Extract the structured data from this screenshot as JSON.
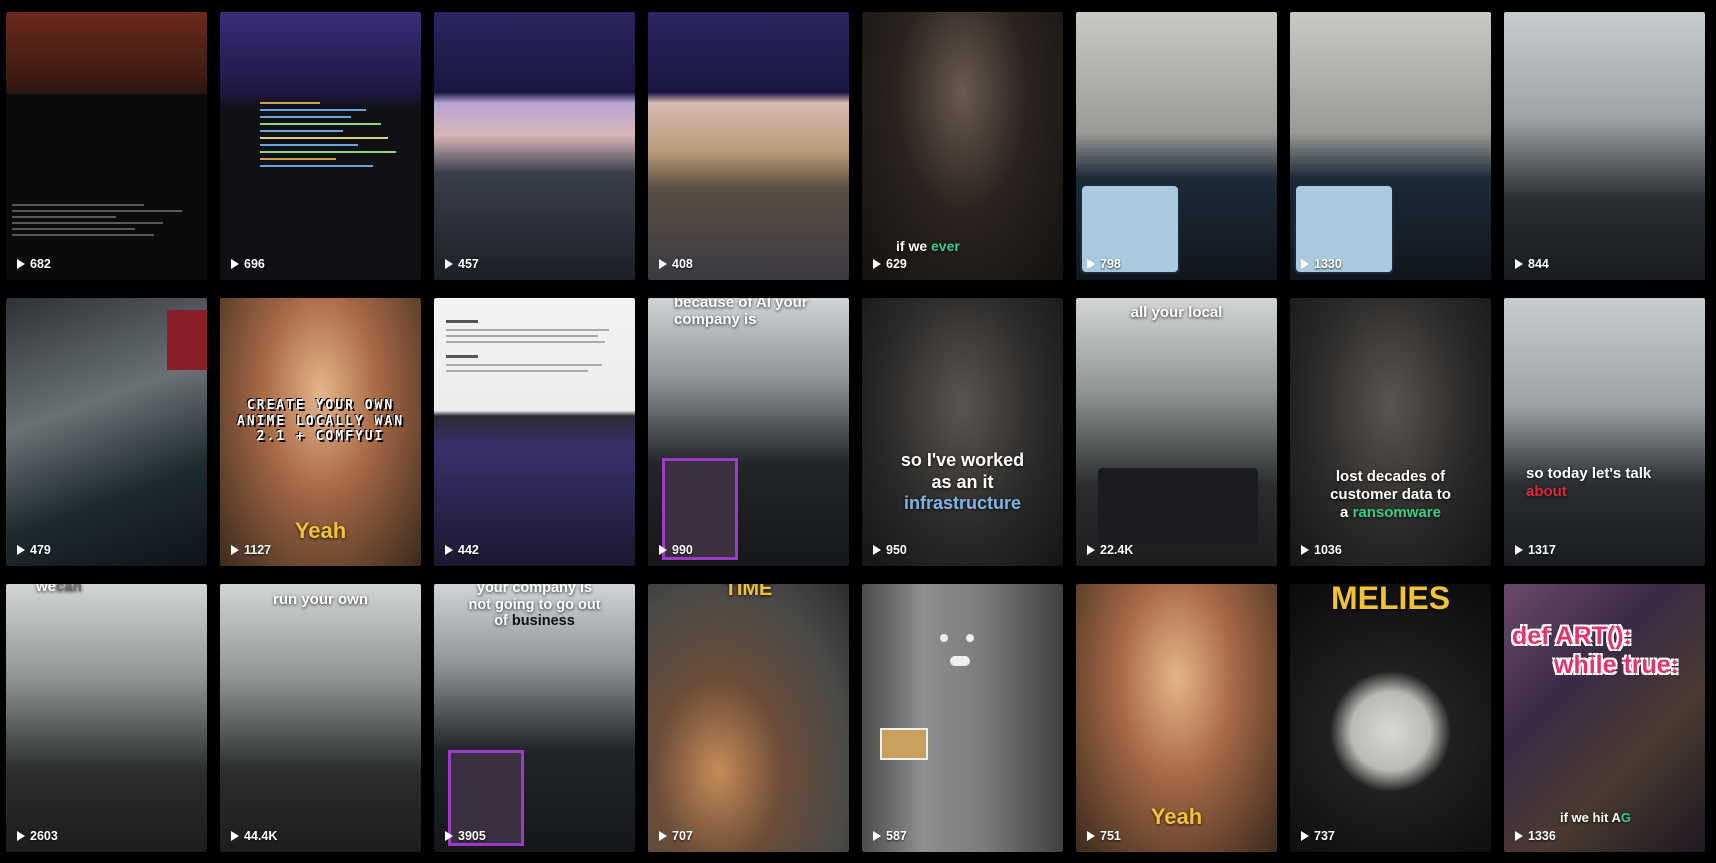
{
  "tiles": [
    {
      "views": "682",
      "theme": "studio-red"
    },
    {
      "views": "696",
      "theme": "studio-purple"
    },
    {
      "views": "457",
      "theme": "stairs"
    },
    {
      "views": "408",
      "theme": "street"
    },
    {
      "views": "629",
      "theme": "dark-person",
      "caption_parts": [
        "if we ",
        "ever"
      ]
    },
    {
      "views": "798",
      "theme": "cap-gallery"
    },
    {
      "views": "1330",
      "theme": "cap-gallery"
    },
    {
      "views": "844",
      "theme": "grey-room"
    },
    {
      "views": "479",
      "theme": "tilt"
    },
    {
      "views": "1127",
      "theme": "anime",
      "pixel_caption": [
        "CREATE YOUR OWN",
        "ANIME LOCALLY WAN",
        "2.1 + COMFYUI"
      ],
      "bottom_word": "Yeah"
    },
    {
      "views": "442",
      "theme": "doc"
    },
    {
      "views": "990",
      "theme": "cap-dark",
      "top_caption_lines": [
        "because of AI your",
        "company is"
      ]
    },
    {
      "views": "950",
      "theme": "person-dark",
      "caption_lines": [
        "so I've worked",
        "as an it"
      ],
      "caption_accent": "infrastructure"
    },
    {
      "views": "22.4K",
      "theme": "person-gallery",
      "top_caption_lines": [
        "all your local"
      ]
    },
    {
      "views": "1036",
      "theme": "person-dark",
      "caption_lines": [
        "lost decades of",
        "customer data to"
      ],
      "caption_tail": [
        "a ",
        "ransomware"
      ]
    },
    {
      "views": "1317",
      "theme": "grey-room",
      "caption_lines": [
        "so today let's talk"
      ],
      "caption_accent": "about"
    },
    {
      "views": "2603",
      "theme": "person-gallery",
      "top_caption_parts": [
        "we",
        "can"
      ]
    },
    {
      "views": "44.4K",
      "theme": "person-gallery",
      "top_caption_lines": [
        "run your own"
      ]
    },
    {
      "views": "3905",
      "theme": "cap-dark",
      "top_caption_lines": [
        "your company is",
        "not going to go out"
      ],
      "top_caption_tail": [
        "of ",
        "business"
      ]
    },
    {
      "views": "707",
      "theme": "cat",
      "top_caption_lines": [
        "TIME"
      ]
    },
    {
      "views": "587",
      "theme": "fridge"
    },
    {
      "views": "751",
      "theme": "anime",
      "bottom_word": "Yeah"
    },
    {
      "views": "737",
      "theme": "moon",
      "top_caption_lines": [
        "MELIES"
      ]
    },
    {
      "views": "1336",
      "theme": "art",
      "code_lines": [
        "def ART():",
        "while true:"
      ],
      "bottom_caption_parts": [
        "if we hit A",
        "G"
      ]
    }
  ],
  "colors": {
    "background": "#000000",
    "accent_green": "#2fd08b",
    "accent_blue": "#7fb6e6",
    "accent_red": "#e0263e",
    "accent_yellow": "#f2c230",
    "art_code_text": "#e8336a"
  },
  "icons": {
    "views": "play-icon"
  }
}
